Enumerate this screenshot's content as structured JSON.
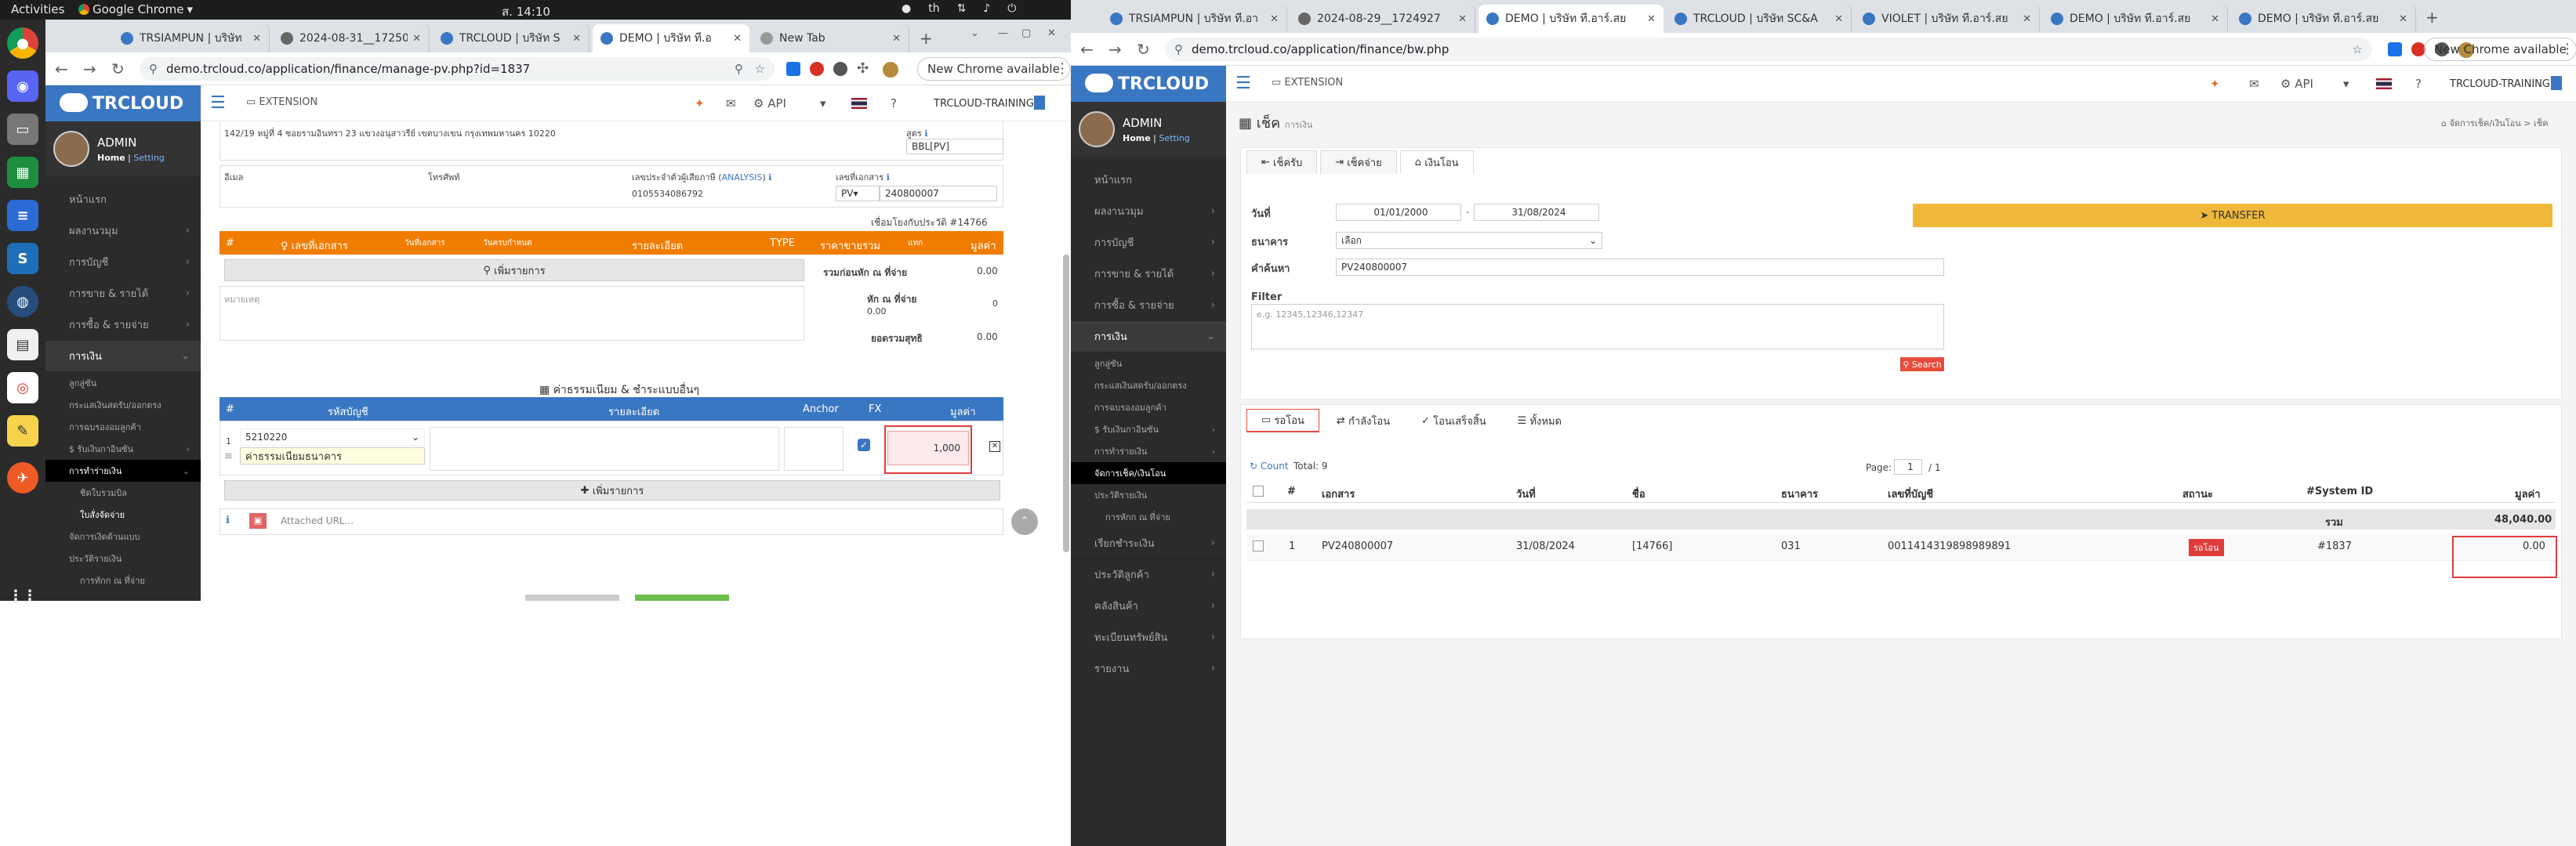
{
  "os": {
    "activities": "Activities",
    "app": "Google Chrome",
    "clock": "ส. 14:10",
    "lang": "th"
  },
  "left": {
    "tabs": [
      "TRSIAMPUN | บริษัท",
      "2024-08-31__17250",
      "TRCLOUD | บริษัท S",
      "DEMO | บริษัท ที.อ",
      "New Tab"
    ],
    "url": "demo.trcloud.co/application/finance/manage-pv.php?id=1837",
    "new_chrome": "New Chrome available",
    "logo": "TRCLOUD",
    "user": {
      "name": "ADMIN",
      "home": "Home",
      "setting": "Setting"
    },
    "menu": [
      "หน้าแรก",
      "ผลงานวมุม",
      "การบัญชี",
      "การขาย & รายได้",
      "การซื้อ & รายจ่าย",
      "การเงิน"
    ],
    "submenu": [
      "ลูกลู่ซัน",
      "กระแสเงินสดรับ/ออกตรง",
      "การฉบรองอมลูกค้า",
      "$ รับเงินกาอินซัน",
      "การทำร่ายเงิน",
      "ชิดใบรวมบิล",
      "ใบสั่งจัดจ่าย",
      "จัดการเงิดด้านแบบ",
      "ประวัติรายเงิน",
      "การทักก ณ ที่จ่าย"
    ],
    "header": {
      "extension": "EXTENSION",
      "api": "API",
      "training": "TRCLOUD-TRAINING"
    },
    "address": "142/19 หมู่ที่ 4 ซอยรามอินทรา 23 แขวงอนุสาวรีย์ เขตบางเขน กรุงเทพมหานคร 10220",
    "source_label": "สูตร",
    "source_value": "BBL[PV]",
    "email_label": "อีเมล",
    "phone_label": "โทรศัพท์",
    "taxid_label": "เลขประจำตัวผู้เสียภาษี",
    "analysis": "ANALYSIS",
    "taxid": "0105534086792",
    "docno_label": "เลขที่เอกสาร",
    "doc_prefix": "PV",
    "doc_no": "240800007",
    "linked": "เชื่อมโยงกับประวัติ #14766",
    "orange_cols": [
      "#",
      "เลขที่เอกสาร",
      "วันที่เอกสาร",
      "วันครบกำหนด",
      "รายละเอียด",
      "TYPE",
      "ราคาขายรวม",
      "แทก",
      "มูลค่า"
    ],
    "add_doc": "เพิ่มรายการ",
    "total_before": "รวมก่อนหัก ณ ที่จ่าย",
    "total_before_val": "0.00",
    "wht_label": "หัก ณ ที่จ่าย",
    "wht_val": "0.00",
    "wht_val2": "0",
    "note_placeholder": "หมายเหตุ",
    "net_label": "ยอดรวมสุทธิ",
    "net_val": "0.00",
    "fees_title": "ค่าธรรมเนียม & ชำระแบบอื่นๆ",
    "blue_cols": [
      "#",
      "รหัสบัญชี",
      "รายละเอียด",
      "Anchor",
      "FX",
      "มูลค่า"
    ],
    "fee_row": {
      "no": "1",
      "account": "5210220",
      "desc": "ค่าธรรมเนียมธนาคาร",
      "amount": "1,000"
    },
    "add_item": "เพิ่มรายการ",
    "attached_placeholder": "Attached URL..."
  },
  "right": {
    "tabs": [
      "TRSIAMPUN | บริษัท ที.อา",
      "2024-08-29__1724927",
      "DEMO | บริษัท ที.อาร์.สย",
      "TRCLOUD | บริษัท SC&A",
      "VIOLET | บริษัท ที.อาร์.สย",
      "DEMO | บริษัท ที.อาร์.สย",
      "DEMO | บริษัท ที.อาร์.สย"
    ],
    "url": "demo.trcloud.co/application/finance/bw.php",
    "new_chrome": "New Chrome available",
    "logo": "TRCLOUD",
    "user": {
      "name": "ADMIN",
      "home": "Home",
      "setting": "Setting"
    },
    "menu": [
      "หน้าแรก",
      "ผลงานวมุม",
      "การบัญชี",
      "การขาย & รายได้",
      "การซื้อ & รายจ่าย",
      "การเงิน"
    ],
    "submenu": [
      "ลูกลู่ซัน",
      "กระแสเงินสดรับ/ออกตรง",
      "การฉบรองอมลูกค้า",
      "$ รับเงินกาอินซัน",
      "การทำร่ายเงิน",
      "จัดการเช็ค/เงินโอน",
      "ประวัติรายเงิน",
      "การหักก ณ ที่จ่าย"
    ],
    "menu2": [
      "เรียกชำระเงิน",
      "ประวัติลูกค้า",
      "คลังสินค้า",
      "ทะเบียนทรัพย์สิน",
      "รายงาน"
    ],
    "header": {
      "extension": "EXTENSION",
      "api": "API",
      "training": "TRCLOUD-TRAINING"
    },
    "page_title": "เช็ค",
    "page_sub": "การเงิน",
    "crumb": "จัดการเช็ค/เงินโอน  >  เช็ค",
    "ptabs": [
      "เช็ครับ",
      "เช็คจ่าย",
      "เงินโอน"
    ],
    "date_label": "วันที่",
    "date_from": "01/01/2000",
    "date_to": "31/08/2024",
    "bank_label": "ธนาคาร",
    "bank_value": "เลือก",
    "keyword_label": "คำค้นหา",
    "keyword_value": "PV240800007",
    "filter_label": "Filter",
    "filter_placeholder": "e.g. 12345,12346,12347",
    "search_btn": "Search",
    "transfer_btn": "TRANSFER",
    "stabs": [
      "รอโอน",
      "กำลังโอน",
      "โอนเสร็จสิ้น",
      "ทั้งหมด"
    ],
    "count_label": "Count",
    "total_label": "Total: 9",
    "page_label": "Page:",
    "page_no": "1",
    "page_of": "/ 1",
    "cols": [
      "#",
      "เอกสาร",
      "วันที่",
      "ชื่อ",
      "ธนาคาร",
      "เลขที่บัญชี",
      "สถานะ",
      "#System ID",
      "มูลค่า"
    ],
    "sum_label": "รวม",
    "sum_val": "48,040.00",
    "row": {
      "no": "1",
      "doc": "PV240800007",
      "date": "31/08/2024",
      "name": "[14766]",
      "bank": "031",
      "acct": "0011414319898989891",
      "status": "รอโอน",
      "sysid": "#1837",
      "amount": "0.00"
    }
  }
}
